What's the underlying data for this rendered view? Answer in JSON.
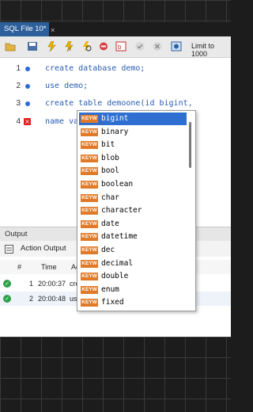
{
  "tab": {
    "title": "SQL File 10*",
    "close": "×"
  },
  "toolbar": {
    "limit_label": "Limit to 1000"
  },
  "editor": {
    "lines": [
      {
        "num": "1",
        "marker": "dot",
        "tokens": [
          {
            "t": "create database demo;",
            "k": "kw"
          }
        ]
      },
      {
        "num": "2",
        "marker": "dot",
        "tokens": [
          {
            "t": "use demo;",
            "k": "kw"
          }
        ]
      },
      {
        "num": "3",
        "marker": "dot",
        "tokens": [
          {
            "t": "create table demoone(id bigint,",
            "k": "kw"
          }
        ]
      },
      {
        "num": "4",
        "marker": "error",
        "tokens": [
          {
            "t": "name varchar(",
            "k": "kw"
          }
        ]
      }
    ]
  },
  "autocomplete": {
    "badge": "KEYW",
    "items": [
      "bigint",
      "binary",
      "bit",
      "blob",
      "bool",
      "boolean",
      "char",
      "character",
      "date",
      "datetime",
      "dec",
      "decimal",
      "double",
      "enum",
      "fixed"
    ],
    "selected_index": 0
  },
  "output": {
    "title": "Output",
    "selector_label": "Action Output",
    "columns": {
      "num": "#",
      "time": "Time",
      "action": "Ac"
    },
    "rows": [
      {
        "num": "1",
        "time": "20:00:37",
        "action": "cre"
      },
      {
        "num": "2",
        "time": "20:00:48",
        "action": "use"
      }
    ]
  }
}
